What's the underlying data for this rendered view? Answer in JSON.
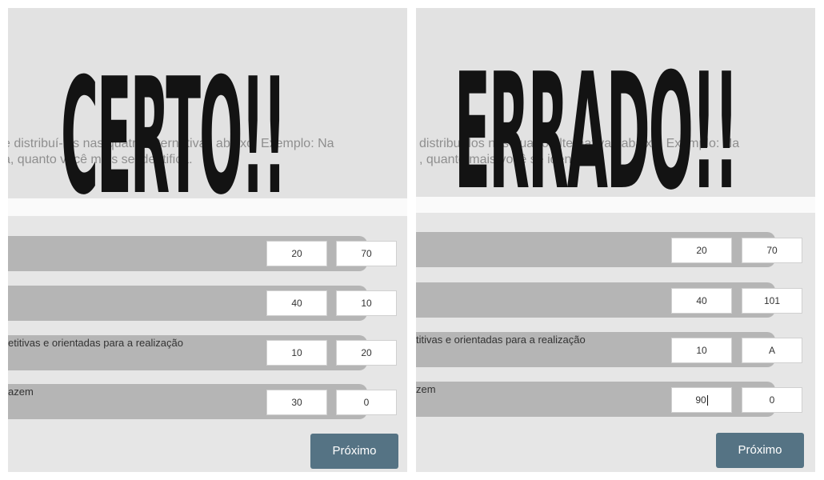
{
  "left_panel": {
    "title": "CERTO!!",
    "instruction_lines": [
      "e distribuí-los nas quatro alternativas abaixo. Exemplo: Na",
      "a, quanto você mais se identifica."
    ],
    "rows": [
      {
        "text": "",
        "values": [
          "20",
          "70"
        ]
      },
      {
        "text": "",
        "values": [
          "40",
          "10"
        ]
      },
      {
        "text": "etitivas e orientadas para a realização",
        "values": [
          "10",
          "20"
        ]
      },
      {
        "text": "azem",
        "values": [
          "30",
          "0"
        ]
      }
    ],
    "next_button": "Próximo"
  },
  "right_panel": {
    "title": "ERRADO!!",
    "instruction_lines": [
      "distribuí-los nas quatro alternativas abaixo. Exemplo: Na",
      ", quanto mais você se identifica."
    ],
    "rows": [
      {
        "text": "",
        "values": [
          "20",
          "70"
        ]
      },
      {
        "text": "",
        "values": [
          "40",
          "101"
        ]
      },
      {
        "text": "titivas e orientadas para a realização",
        "values": [
          "10",
          "A"
        ]
      },
      {
        "text": "zem",
        "values": [
          "90",
          "0"
        ]
      }
    ],
    "next_button": "Próximo"
  },
  "colors": {
    "button": "#557384",
    "row_bar": "#b5b5b5",
    "panel_bg": "#e6e6e6",
    "overlay_text": "#131313"
  }
}
